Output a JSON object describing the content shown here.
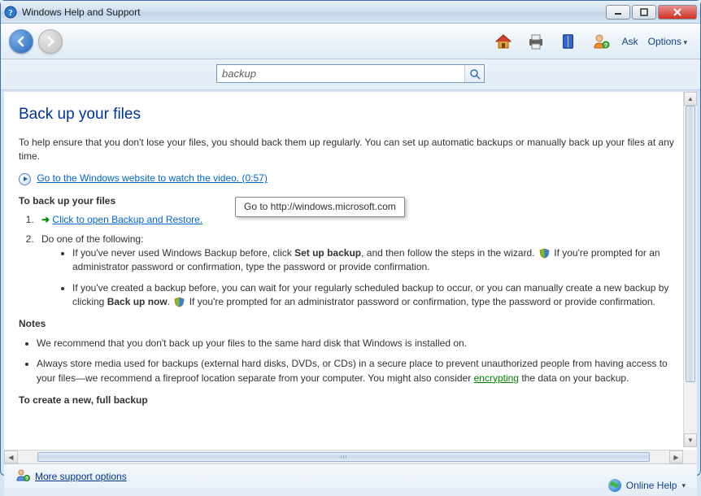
{
  "window": {
    "title": "Windows Help and Support"
  },
  "toolbar": {
    "ask": "Ask",
    "options": "Options"
  },
  "search": {
    "value": "backup"
  },
  "article": {
    "title": "Back up your files",
    "intro": "To help ensure that you don't lose your files, you should back them up regularly. You can set up automatic backups or manually back up your files at any time.",
    "video_link": "Go to the Windows website to watch the video. (0:57)",
    "tooltip": "Go to http://windows.microsoft.com",
    "steps_heading": "To back up your files",
    "step1_link": "Click to open Backup and Restore.",
    "step2_text": "Do one of the following:",
    "bullet1_a": "If you've never used Windows Backup before, click ",
    "bullet1_bold": "Set up backup",
    "bullet1_b": ", and then follow the steps in the wizard. ",
    "bullet1_c": "If you're prompted for an administrator password or confirmation, type the password or provide confirmation.",
    "bullet2_a": "If you've created a backup before, you can wait for your regularly scheduled backup to occur, or you can manually create a new backup by clicking ",
    "bullet2_bold": "Back up now",
    "bullet2_b": ". ",
    "bullet2_c": "If you're prompted for an administrator password or confirmation, type the password or provide confirmation.",
    "notes_heading": "Notes",
    "note1": "We recommend that you don't back up your files to the same hard disk that Windows is installed on.",
    "note2_a": "Always store media used for backups (external hard disks, DVDs, or CDs) in a secure place to prevent unauthorized people from having access to your files—we recommend a fireproof location separate from your computer. You might also consider ",
    "note2_link": "encrypting",
    "note2_b": " the data on your backup.",
    "create_heading": "To create a new, full backup"
  },
  "statusbar": {
    "more": "More support options",
    "online": "Online Help"
  }
}
